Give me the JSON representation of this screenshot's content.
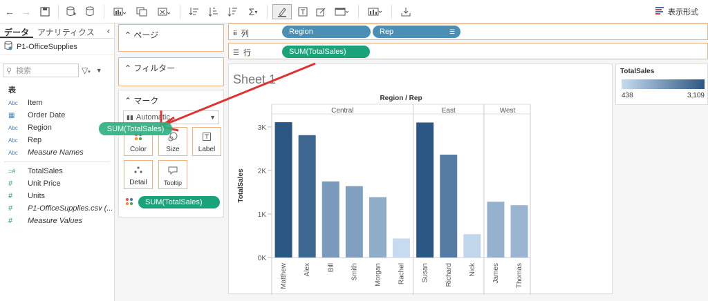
{
  "toolbar": {
    "show_me_label": "表示形式"
  },
  "left_pane": {
    "tabs": [
      "データ",
      "アナリティクス"
    ],
    "datasource": "P1-OfficeSupplies",
    "search_placeholder": "検索",
    "section_title": "表",
    "dimensions": [
      {
        "type": "Abc",
        "label": "Item",
        "italic": false
      },
      {
        "type": "date",
        "label": "Order Date",
        "italic": false
      },
      {
        "type": "Abc",
        "label": "Region",
        "italic": false
      },
      {
        "type": "Abc",
        "label": "Rep",
        "italic": false
      },
      {
        "type": "Abc",
        "label": "Measure Names",
        "italic": true
      }
    ],
    "measures": [
      {
        "type": "calc",
        "label": "TotalSales",
        "italic": false
      },
      {
        "type": "num",
        "label": "Unit Price",
        "italic": false
      },
      {
        "type": "num",
        "label": "Units",
        "italic": false
      },
      {
        "type": "num",
        "label": "P1-OfficeSupplies.csv (...",
        "italic": true
      },
      {
        "type": "num",
        "label": "Measure Values",
        "italic": true
      }
    ]
  },
  "cards": {
    "pages": "ページ",
    "filters": "フィルター",
    "marks": "マーク",
    "mark_type": "Automatic",
    "buttons": [
      "Color",
      "Size",
      "Label",
      "Detail",
      "Tooltip"
    ],
    "color_pill": "SUM(TotalSales)"
  },
  "shelves": {
    "columns_label": "列",
    "rows_label": "行",
    "columns_pills": [
      "Region",
      "Rep"
    ],
    "rows_pill": "SUM(TotalSales)"
  },
  "drag_pill": "SUM(TotalSales)",
  "sheet_title": "Sheet 1",
  "header_title": "Region / Rep",
  "legend": {
    "title": "TotalSales",
    "min_label": "438",
    "max_label": "3,109",
    "color_low": "#c6dbef",
    "color_high": "#2c5785"
  },
  "chart_data": {
    "type": "bar",
    "title": "",
    "ylabel": "TotalSales",
    "xlabel": "",
    "ylim": [
      0,
      3300
    ],
    "yticks": [
      "0K",
      "1K",
      "2K",
      "3K"
    ],
    "groups": [
      {
        "name": "Central",
        "categories": [
          "Matthew",
          "Alex",
          "Bill",
          "Smith",
          "Morgan",
          "Rachel"
        ],
        "values": [
          3109,
          2812,
          1749,
          1641,
          1387,
          438
        ]
      },
      {
        "name": "East",
        "categories": [
          "Susan",
          "Richard",
          "Nick"
        ],
        "values": [
          3102,
          2364,
          536
        ]
      },
      {
        "name": "West",
        "categories": [
          "James",
          "Thomas"
        ],
        "values": [
          1283,
          1203
        ]
      }
    ]
  }
}
